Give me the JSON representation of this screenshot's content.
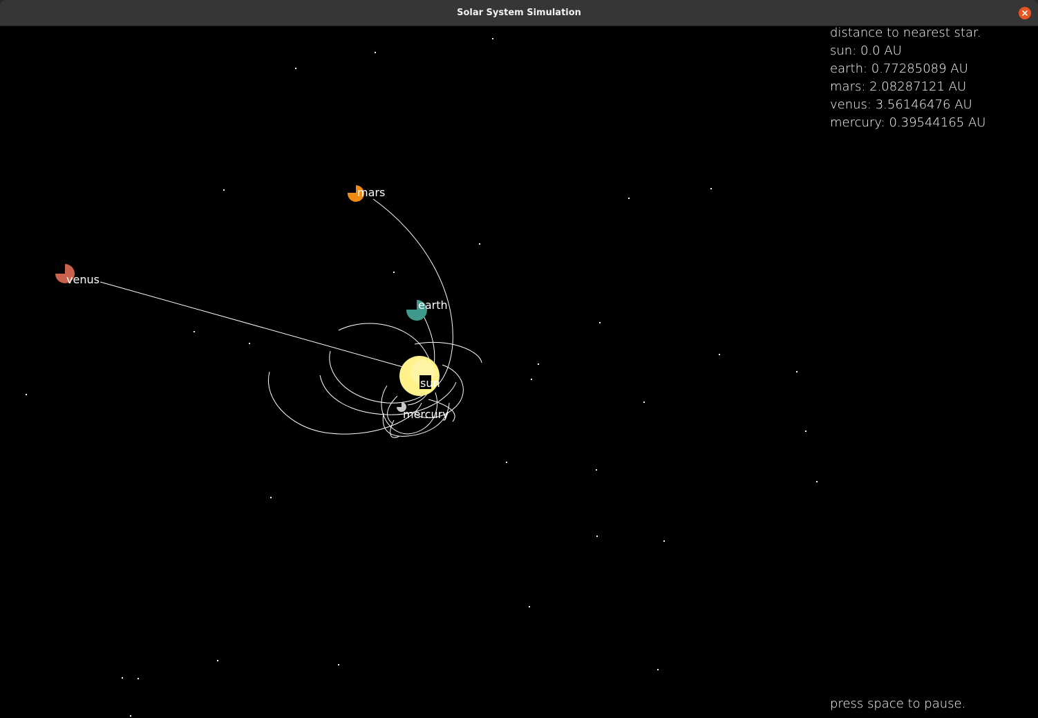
{
  "window": {
    "title": "Solar System Simulation",
    "close_icon": "close-icon"
  },
  "hud": {
    "title": "distance to nearest star.",
    "rows": [
      "sun: 0.0 AU",
      "earth: 0.77285089 AU",
      "mars: 2.08287121 AU",
      "venus: 3.56146476 AU",
      "mercury: 0.39544165 AU"
    ]
  },
  "hint": "press space to pause.",
  "bodies": {
    "sun": {
      "label": "sun",
      "color": "#fff28a"
    },
    "earth": {
      "label": "earth",
      "color": "#3f9a8c"
    },
    "mars": {
      "label": "mars",
      "color": "#f08a12"
    },
    "venus": {
      "label": "venus",
      "color": "#c8624c"
    },
    "mercury": {
      "label": "mercury",
      "color": "#c8c8c8"
    }
  },
  "colors": {
    "background": "#000000",
    "titlebar": "#363636",
    "close": "#e95420",
    "orbit_trail": "#ffffff"
  }
}
